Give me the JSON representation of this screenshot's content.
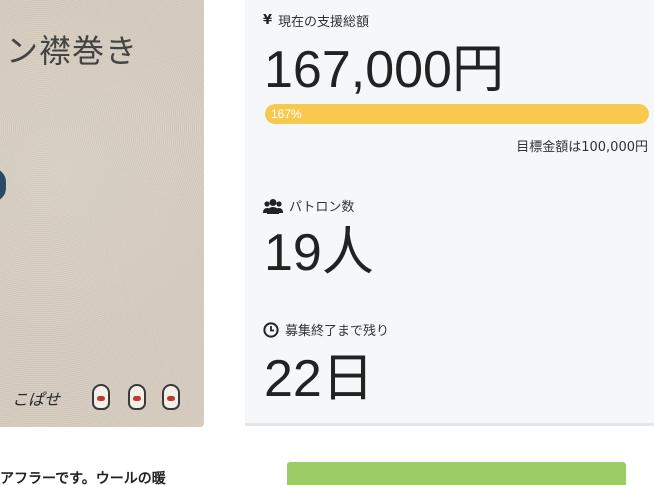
{
  "photo": {
    "caption": "ン襟巻き",
    "logo_text": "こぱせ"
  },
  "funding": {
    "label": "現在の支援総額",
    "amount": "167,000円",
    "progress_label": "167%",
    "progress": 1.0,
    "goal_text": "目標金額は100,000円"
  },
  "patrons": {
    "label": "パトロン数",
    "count": "19人"
  },
  "remaining": {
    "label": "募集終了まで残り",
    "value": "22日"
  },
  "description_snippet": "アフラーです。ウールの暖",
  "colors": {
    "progress": "#f7c94f",
    "button": "#9ccc65",
    "card": "#f6f7f9"
  },
  "icons": {
    "funding": "yen-icon",
    "patrons": "users-icon",
    "remaining": "clock-icon"
  }
}
